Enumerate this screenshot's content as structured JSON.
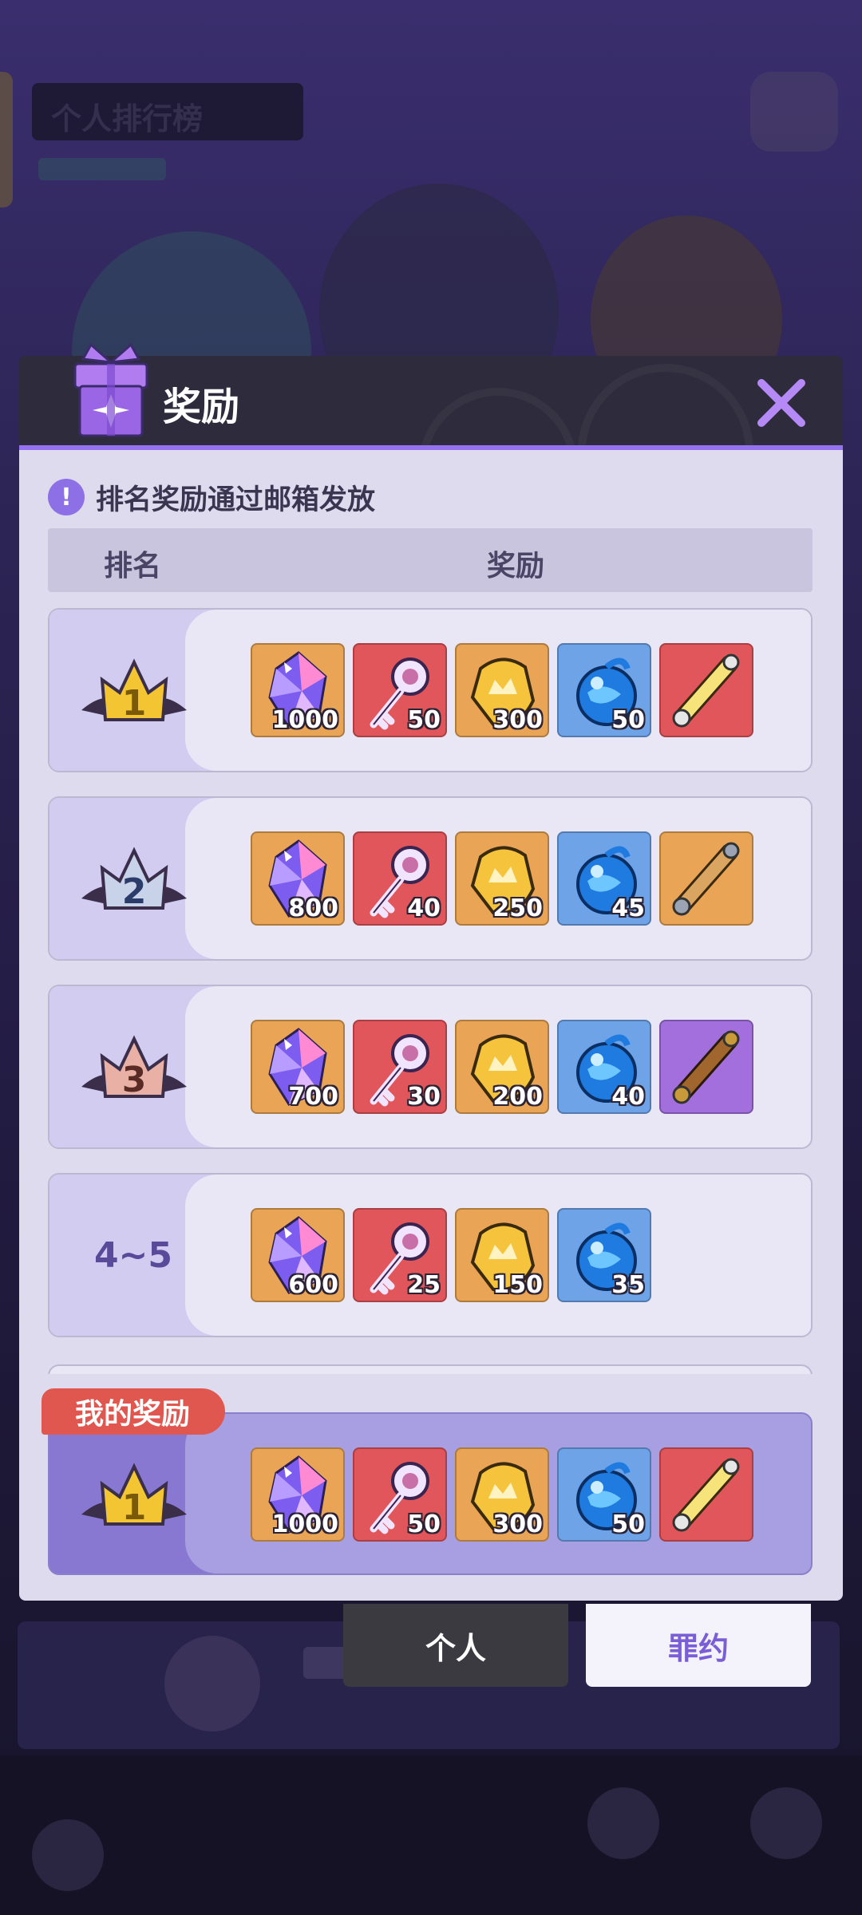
{
  "background": {
    "title": "个人排行榜"
  },
  "modal": {
    "title": "奖励",
    "notice": "排名奖励通过邮箱发放",
    "header_rank": "排名",
    "header_reward": "奖励"
  },
  "rows": [
    {
      "rank": "1",
      "items": [
        {
          "type": "crystal",
          "qty": "1000"
        },
        {
          "type": "key",
          "qty": "50"
        },
        {
          "type": "gold",
          "qty": "300"
        },
        {
          "type": "orb",
          "qty": "50"
        },
        {
          "type": "scroll-gold",
          "qty": ""
        }
      ]
    },
    {
      "rank": "2",
      "items": [
        {
          "type": "crystal",
          "qty": "800"
        },
        {
          "type": "key",
          "qty": "40"
        },
        {
          "type": "gold",
          "qty": "250"
        },
        {
          "type": "orb",
          "qty": "45"
        },
        {
          "type": "scroll-silver",
          "qty": ""
        }
      ]
    },
    {
      "rank": "3",
      "items": [
        {
          "type": "crystal",
          "qty": "700"
        },
        {
          "type": "key",
          "qty": "30"
        },
        {
          "type": "gold",
          "qty": "200"
        },
        {
          "type": "orb",
          "qty": "40"
        },
        {
          "type": "scroll-bronze",
          "qty": ""
        }
      ]
    },
    {
      "rank": "4~5",
      "items": [
        {
          "type": "crystal",
          "qty": "600"
        },
        {
          "type": "key",
          "qty": "25"
        },
        {
          "type": "gold",
          "qty": "150"
        },
        {
          "type": "orb",
          "qty": "35"
        }
      ]
    }
  ],
  "my_reward": {
    "label": "我的奖励",
    "rank": "1",
    "items": [
      {
        "type": "crystal",
        "qty": "1000"
      },
      {
        "type": "key",
        "qty": "50"
      },
      {
        "type": "gold",
        "qty": "300"
      },
      {
        "type": "orb",
        "qty": "50"
      },
      {
        "type": "scroll-gold",
        "qty": ""
      }
    ]
  },
  "tabs": {
    "personal": "个人",
    "guild": "罪约"
  },
  "colors": {
    "accent": "#9573f0",
    "tag_red": "#e0574f",
    "gold": "#f3c533",
    "silver": "#c8d2e8",
    "bronze": "#e9b0a6"
  }
}
